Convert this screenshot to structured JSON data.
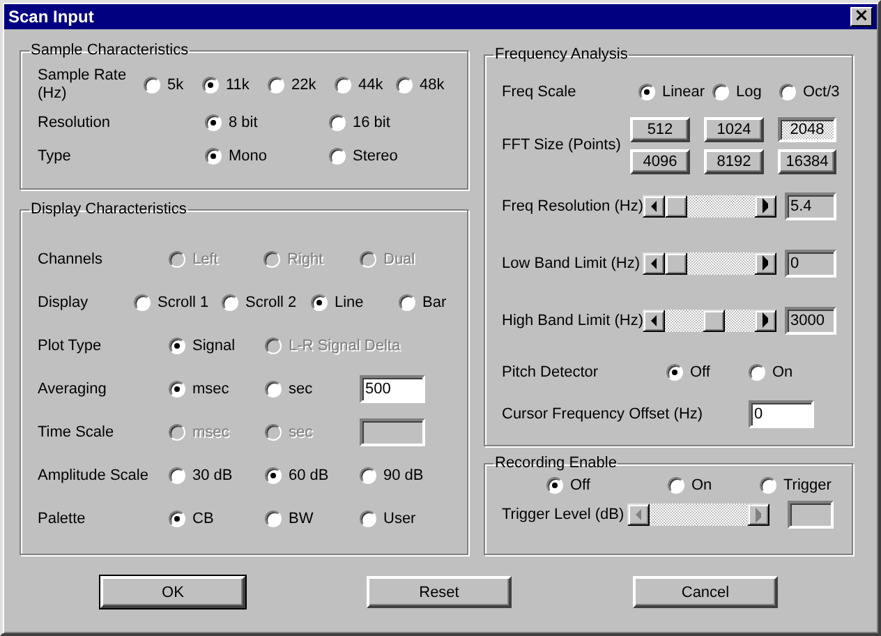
{
  "window": {
    "title": "Scan Input",
    "close_label": "×"
  },
  "sample_characteristics": {
    "title": "Sample Characteristics",
    "rows": [
      {
        "label": "Sample Rate (Hz)",
        "options": [
          {
            "label": "5k",
            "selected": false,
            "disabled": false
          },
          {
            "label": "11k",
            "selected": true,
            "disabled": false
          },
          {
            "label": "22k",
            "selected": false,
            "disabled": false
          },
          {
            "label": "44k",
            "selected": false,
            "disabled": false
          },
          {
            "label": "48k",
            "selected": false,
            "disabled": false
          }
        ]
      },
      {
        "label": "Resolution",
        "options": [
          {
            "label": "8 bit",
            "selected": true,
            "disabled": false
          },
          {
            "label": "16 bit",
            "selected": false,
            "disabled": false
          }
        ]
      },
      {
        "label": "Type",
        "options": [
          {
            "label": "Mono",
            "selected": true,
            "disabled": false
          },
          {
            "label": "Stereo",
            "selected": false,
            "disabled": false
          }
        ]
      }
    ]
  },
  "display_characteristics": {
    "title": "Display Characteristics",
    "rows": [
      {
        "label": "Channels",
        "options": [
          {
            "label": "Left",
            "selected": false,
            "disabled": true
          },
          {
            "label": "Right",
            "selected": false,
            "disabled": true
          },
          {
            "label": "Dual",
            "selected": false,
            "disabled": true
          }
        ]
      },
      {
        "label": "Display",
        "options": [
          {
            "label": "Scroll 1",
            "selected": false,
            "disabled": false
          },
          {
            "label": "Scroll 2",
            "selected": false,
            "disabled": false
          },
          {
            "label": "Line",
            "selected": true,
            "disabled": false
          },
          {
            "label": "Bar",
            "selected": false,
            "disabled": false
          }
        ]
      },
      {
        "label": "Plot Type",
        "options": [
          {
            "label": "Signal",
            "selected": true,
            "disabled": false
          },
          {
            "label": "L-R Signal Delta",
            "selected": false,
            "disabled": true
          }
        ]
      },
      {
        "label": "Averaging",
        "options": [
          {
            "label": "msec",
            "selected": true,
            "disabled": false
          },
          {
            "label": "sec",
            "selected": false,
            "disabled": false
          }
        ],
        "field": {
          "value": "500",
          "disabled": false
        }
      },
      {
        "label": "Time Scale",
        "options": [
          {
            "label": "msec",
            "selected": false,
            "disabled": true
          },
          {
            "label": "sec",
            "selected": false,
            "disabled": true
          }
        ],
        "field": {
          "disabled": true
        }
      },
      {
        "label": "Amplitude Scale",
        "options": [
          {
            "label": "30 dB",
            "selected": false,
            "disabled": false
          },
          {
            "label": "60 dB",
            "selected": true,
            "disabled": false
          },
          {
            "label": "90 dB",
            "selected": false,
            "disabled": false
          }
        ]
      },
      {
        "label": "Palette",
        "options": [
          {
            "label": "CB",
            "selected": true,
            "disabled": false
          },
          {
            "label": "BW",
            "selected": false,
            "disabled": false
          },
          {
            "label": "User",
            "selected": false,
            "disabled": false
          }
        ]
      }
    ]
  },
  "frequency_analysis": {
    "title": "Frequency Analysis",
    "freq_scale": {
      "label": "Freq Scale",
      "options": [
        {
          "label": "Linear",
          "selected": true,
          "disabled": false
        },
        {
          "label": "Log",
          "selected": false,
          "disabled": false
        },
        {
          "label": "Oct/3",
          "selected": false,
          "disabled": false
        }
      ]
    },
    "fft_size": {
      "label": "FFT Size (Points)",
      "buttons": [
        {
          "label": "512",
          "selected": false
        },
        {
          "label": "1024",
          "selected": false
        },
        {
          "label": "2048",
          "selected": true
        },
        {
          "label": "4096",
          "selected": false
        },
        {
          "label": "8192",
          "selected": false
        },
        {
          "label": "16384",
          "selected": false
        }
      ]
    },
    "sliders": [
      {
        "label": "Freq Resolution (Hz)",
        "level": 0,
        "value": "5.4",
        "disabled": false
      },
      {
        "label": "Low Band Limit (Hz)",
        "level": 0,
        "value": "0",
        "disabled": false
      },
      {
        "label": "High Band Limit (Hz)",
        "level": 0.57,
        "value": "3000",
        "disabled": false
      }
    ],
    "pitch_detector": {
      "label": "Pitch Detector",
      "options": [
        {
          "label": "Off",
          "selected": true,
          "disabled": false
        },
        {
          "label": "On",
          "selected": false,
          "disabled": false
        }
      ]
    },
    "cursor_offset": {
      "label": "Cursor Frequency Offset (Hz)",
      "value": "0"
    }
  },
  "recording_enable": {
    "title": "Recording Enable",
    "options": [
      {
        "label": "Off",
        "selected": true,
        "disabled": false
      },
      {
        "label": "On",
        "selected": false,
        "disabled": false
      },
      {
        "label": "Trigger",
        "selected": false,
        "disabled": false
      }
    ],
    "trigger_level": {
      "label": "Trigger Level (dB)",
      "disabled": true
    }
  },
  "buttons": [
    {
      "label": "OK",
      "default": true
    },
    {
      "label": "Reset",
      "default": false
    },
    {
      "label": "Cancel",
      "default": false
    }
  ]
}
